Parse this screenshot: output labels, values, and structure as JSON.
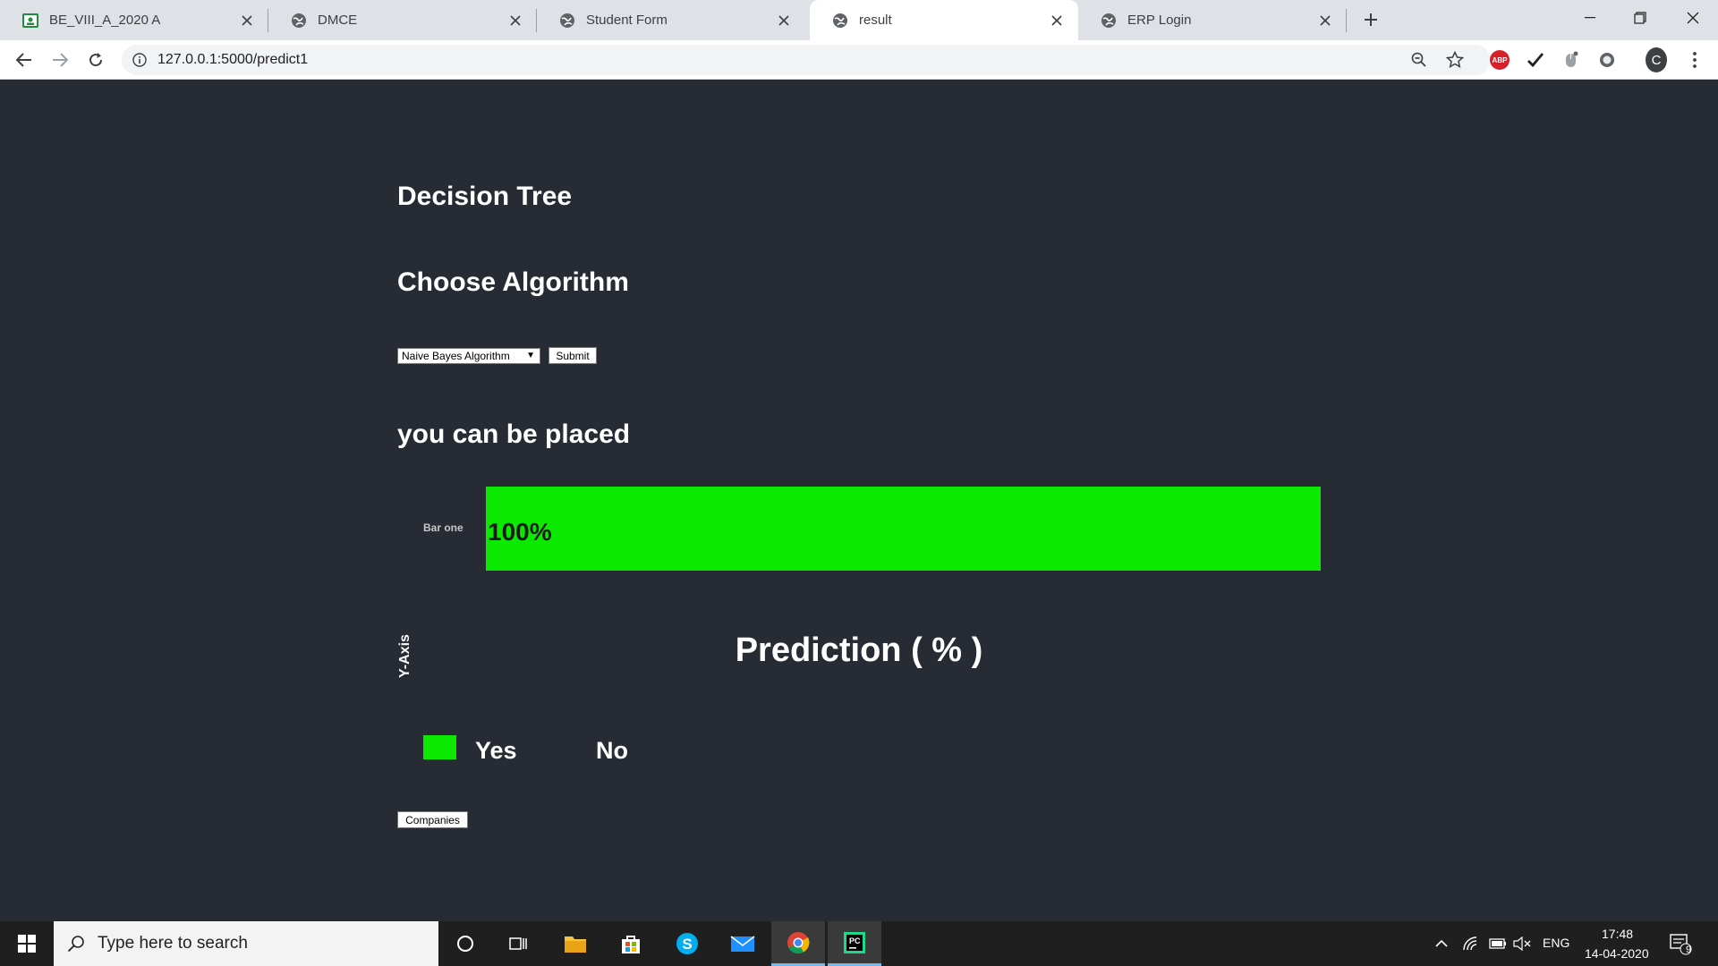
{
  "browser": {
    "tabs": [
      {
        "title": "BE_VIII_A_2020 A",
        "icon": "classroom-icon",
        "active": false
      },
      {
        "title": "DMCE",
        "icon": "globe-icon",
        "active": false
      },
      {
        "title": "Student Form",
        "icon": "globe-icon",
        "active": false
      },
      {
        "title": "result",
        "icon": "globe-icon",
        "active": true
      },
      {
        "title": "ERP Login",
        "icon": "globe-icon",
        "active": false
      }
    ],
    "url": "127.0.0.1:5000/predict1"
  },
  "page": {
    "title": "Decision Tree",
    "choose_heading": "Choose Algorithm",
    "algorithm_select": "Naive Bayes Algorithm",
    "submit_label": "Submit",
    "result_text": "you can be placed",
    "companies_label": "Companies"
  },
  "chart_data": {
    "type": "bar",
    "orientation": "horizontal",
    "categories": [
      "Bar one"
    ],
    "values": [
      100
    ],
    "value_labels": [
      "100%"
    ],
    "title": "Prediction ( % )",
    "ylabel": "Y-Axis",
    "xlim": [
      0,
      100
    ],
    "legend": [
      {
        "name": "Yes",
        "color": "#0bea00"
      },
      {
        "name": "No"
      }
    ],
    "legend_placement": "bottom-left",
    "grid": false
  },
  "taskbar": {
    "search_placeholder": "Type here to search",
    "time": "17:48",
    "date": "14-04-2020",
    "language": "ENG",
    "notification_count": "9"
  }
}
